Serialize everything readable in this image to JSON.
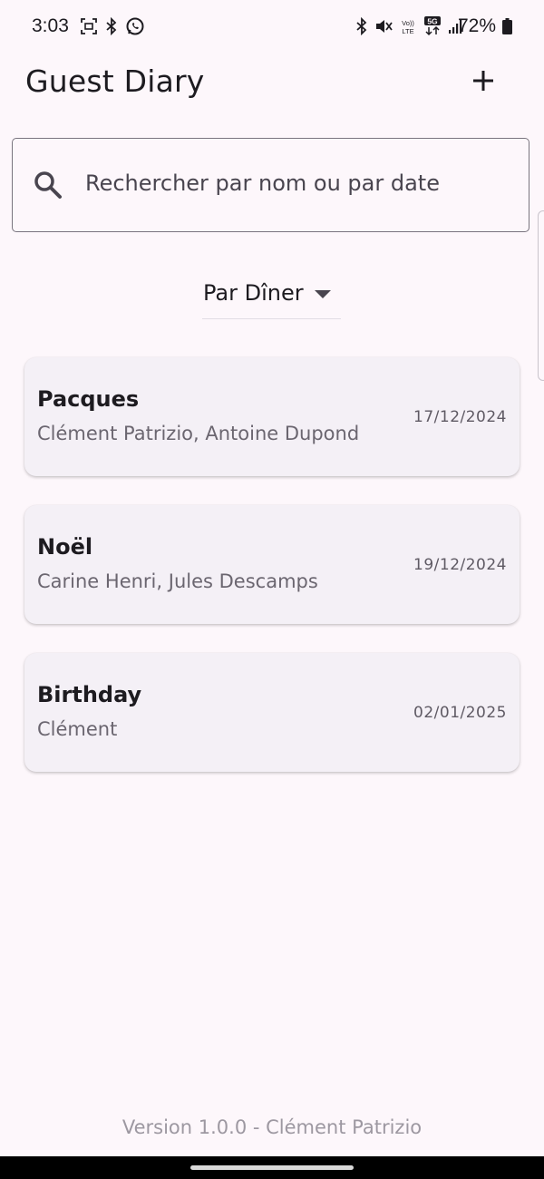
{
  "status_bar": {
    "time": "3:03",
    "battery": "72%",
    "left_icons": [
      "screenshot-icon",
      "bluetooth-icon",
      "whatsapp-icon"
    ],
    "right_icons": [
      "bluetooth-icon",
      "mute-icon",
      "volte-icon",
      "5g-icon",
      "signal-icon",
      "battery-icon"
    ],
    "volte_label": "VoLTE",
    "network_label": "5G"
  },
  "app_bar": {
    "title": "Guest Diary",
    "add_icon": "plus-icon"
  },
  "search": {
    "placeholder": "Rechercher par nom ou par date",
    "icon": "search-icon"
  },
  "sort_dropdown": {
    "selected": "Par Dîner"
  },
  "dinners": [
    {
      "title": "Pacques",
      "guests": "Clément Patrizio, Antoine Dupond",
      "date": "17/12/2024"
    },
    {
      "title": "Noël",
      "guests": "Carine Henri, Jules Descamps",
      "date": "19/12/2024"
    },
    {
      "title": "Birthday",
      "guests": "Clément",
      "date": "02/01/2025"
    }
  ],
  "footer": {
    "version": "Version 1.0.0  -  Clément Patrizio"
  },
  "colors": {
    "background": "#fdf7fb",
    "card": "#f4f0f6",
    "text": "#1d1b20",
    "muted": "#6b6670"
  }
}
